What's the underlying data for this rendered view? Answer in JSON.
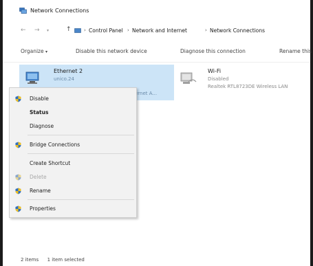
{
  "window": {
    "title": "Network Connections"
  },
  "address": {
    "crumbs": [
      "Control Panel",
      "Network and Internet",
      "Network Connections"
    ]
  },
  "toolbar": {
    "organize": "Organize",
    "disable": "Disable this network device",
    "diagnose": "Diagnose this connection",
    "rename": "Rename this"
  },
  "connections": {
    "ethernet": {
      "name": "Ethernet 2",
      "sub1": "unico.24",
      "sub2": "ernet A..."
    },
    "wifi": {
      "name": "Wi-Fi",
      "status": "Disabled",
      "device": "Realtek RTL8723DE Wireless LAN"
    }
  },
  "context_menu": {
    "items": [
      {
        "label": "Disable",
        "shield": true
      },
      {
        "label": "Status"
      },
      {
        "label": "Diagnose"
      },
      {
        "label": "Bridge Connections",
        "shield": true
      },
      {
        "label": "Create Shortcut"
      },
      {
        "label": "Delete",
        "shield": true
      },
      {
        "label": "Rename",
        "shield": true
      },
      {
        "label": "Properties",
        "shield": true
      }
    ]
  },
  "status": {
    "items": "2 items",
    "selected": "1 item selected"
  }
}
